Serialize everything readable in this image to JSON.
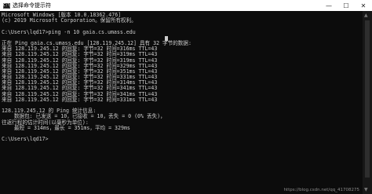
{
  "window": {
    "title": "选择命令提示符",
    "app_icon_glyph": "C:\\",
    "minimize_glyph": "—",
    "maximize_glyph": "☐",
    "close_glyph": "✕"
  },
  "console": {
    "lines": [
      "Microsoft Windows [版本 10.0.18362.476]",
      "(c) 2019 Microsoft Corporation。保留所有权利。",
      "",
      "C:\\Users\\lqd17>ping -n 10 gaia.cs.umass.edu",
      "",
      "正在 Ping gaia.cs.umass.edu [128.119.245.12] 具有 32 字节的数据:",
      "来自 128.119.245.12 的回复: 字节=32 时间=316ms TTL=43",
      "来自 128.119.245.12 的回复: 字节=32 时间=319ms TTL=43",
      "来自 128.119.245.12 的回复: 字节=32 时间=319ms TTL=43",
      "来自 128.119.245.12 的回复: 字节=32 时间=329ms TTL=43",
      "来自 128.119.245.12 的回复: 字节=32 时间=351ms TTL=43",
      "来自 128.119.245.12 的回复: 字节=32 时间=331ms TTL=43",
      "来自 128.119.245.12 的回复: 字节=32 时间=314ms TTL=43",
      "来自 128.119.245.12 的回复: 字节=32 时间=341ms TTL=43",
      "来自 128.119.245.12 的回复: 字节=32 时间=341ms TTL=43",
      "来自 128.119.245.12 的回复: 字节=32 时间=331ms TTL=43",
      "",
      "128.119.245.12 的 Ping 统计信息:",
      "    数据包: 已发送 = 10，已接收 = 10，丢失 = 0 (0% 丢失)，",
      "往返行程的估计时间(以毫秒为单位):",
      "    最短 = 314ms，最长 = 351ms，平均 = 329ms",
      "",
      "C:\\Users\\lqd17>"
    ]
  },
  "scrollbar": {
    "up_glyph": "▲",
    "down_glyph": "▼"
  },
  "watermark": "https://blog.csdn.net/qq_41708275",
  "colors": {
    "background": "#0c0c0c",
    "text": "#cccccc",
    "titlebar": "#ffffff"
  }
}
